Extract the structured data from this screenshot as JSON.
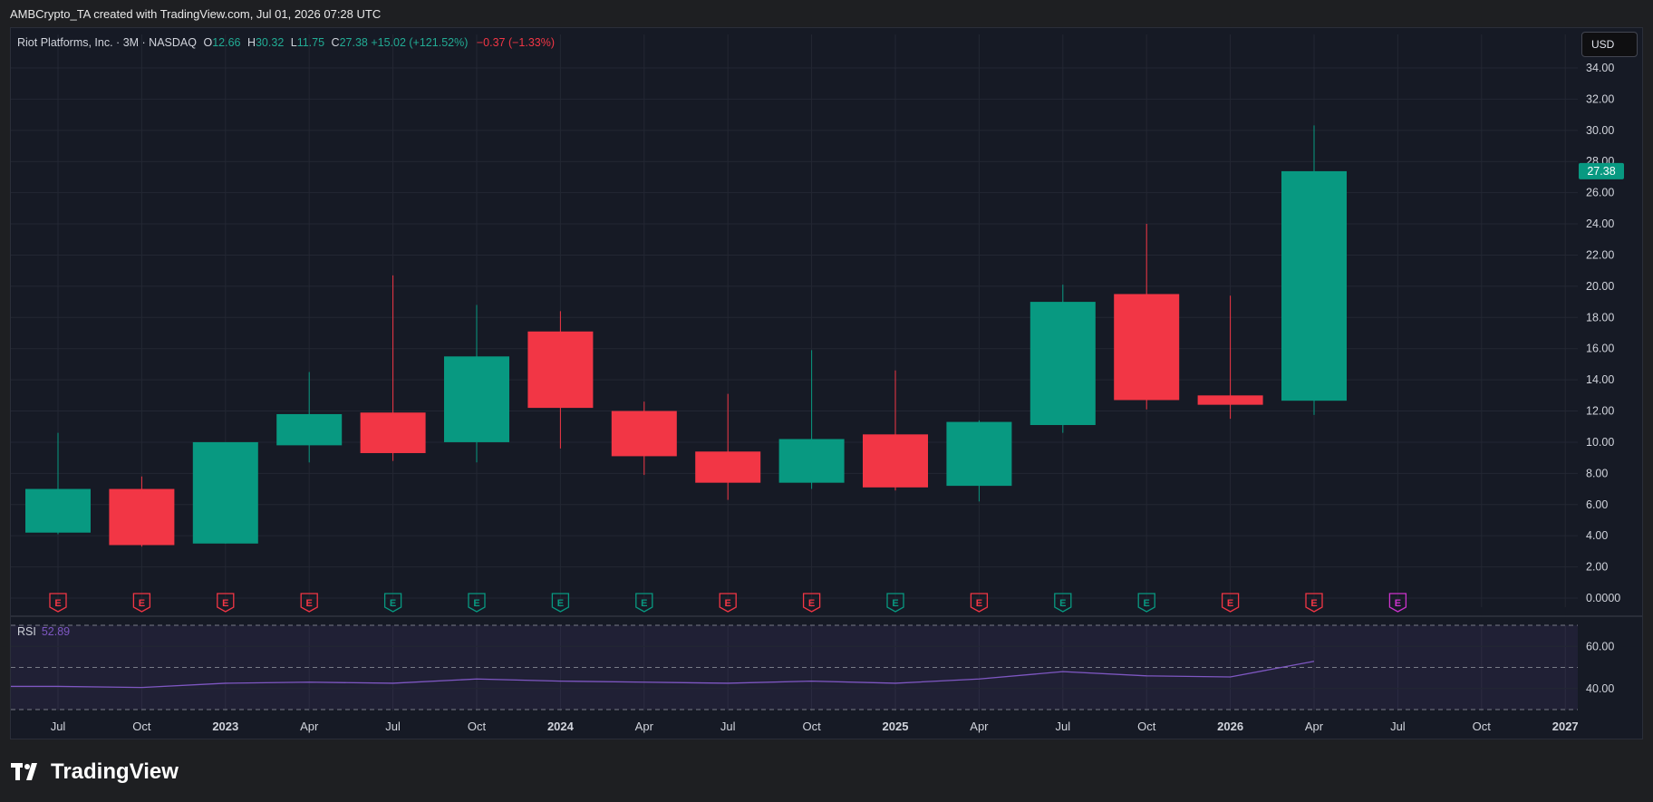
{
  "header": {
    "credit": "AMBCrypto_TA created with TradingView.com, Jul 01, 2026 07:28 UTC"
  },
  "legend": {
    "symbol": "Riot Platforms, Inc. · 3M · NASDAQ",
    "o_label": "O",
    "o_value": "12.66",
    "h_label": "H",
    "h_value": "30.32",
    "l_label": "L",
    "l_value": "11.75",
    "c_label": "C",
    "c_value": "27.38",
    "change": "+15.02 (+121.52%)",
    "day_change": "−0.37 (−1.33%)"
  },
  "currency_button": "USD",
  "rsi": {
    "label": "RSI",
    "value": "52.89"
  },
  "brand": {
    "name": "TradingView"
  },
  "colors": {
    "up": "#089981",
    "down": "#f23645",
    "rsi_line": "#7e57c2",
    "earnings_future": "#cc33cc"
  },
  "chart_data": {
    "type": "candlestick",
    "price_axis": {
      "ylim": [
        0,
        34
      ],
      "ticks": [
        "34.00",
        "32.00",
        "30.00",
        "28.00",
        "26.00",
        "24.00",
        "22.00",
        "20.00",
        "18.00",
        "16.00",
        "14.00",
        "12.00",
        "10.00",
        "8.00",
        "6.00",
        "4.00",
        "2.00",
        "0.0000"
      ],
      "last_price": "27.38"
    },
    "time_axis": {
      "ticks": [
        "Jul",
        "Oct",
        "2023",
        "Apr",
        "Jul",
        "Oct",
        "2024",
        "Apr",
        "Jul",
        "Oct",
        "2025",
        "Apr",
        "Jul",
        "Oct",
        "2026",
        "Apr",
        "Jul",
        "Oct",
        "2027"
      ],
      "bold": [
        "2023",
        "2024",
        "2025",
        "2026",
        "2027"
      ]
    },
    "candles": [
      {
        "period": "Jul 2022",
        "open": 4.2,
        "high": 10.6,
        "low": 4.1,
        "close": 7.0
      },
      {
        "period": "Oct 2022",
        "open": 7.0,
        "high": 7.8,
        "low": 3.3,
        "close": 3.4
      },
      {
        "period": "Jan 2023",
        "open": 3.5,
        "high": 10.0,
        "low": 3.5,
        "close": 10.0
      },
      {
        "period": "Apr 2023",
        "open": 9.8,
        "high": 14.5,
        "low": 8.7,
        "close": 11.8
      },
      {
        "period": "Jul 2023",
        "open": 11.9,
        "high": 20.7,
        "low": 8.8,
        "close": 9.3
      },
      {
        "period": "Oct 2023",
        "open": 10.0,
        "high": 18.8,
        "low": 8.7,
        "close": 15.5
      },
      {
        "period": "Jan 2024",
        "open": 17.1,
        "high": 18.4,
        "low": 9.6,
        "close": 12.2
      },
      {
        "period": "Apr 2024",
        "open": 12.0,
        "high": 12.6,
        "low": 7.9,
        "close": 9.1
      },
      {
        "period": "Jul 2024",
        "open": 9.4,
        "high": 13.1,
        "low": 6.3,
        "close": 7.4
      },
      {
        "period": "Oct 2024",
        "open": 7.4,
        "high": 15.9,
        "low": 7.0,
        "close": 10.2
      },
      {
        "period": "Jan 2025",
        "open": 10.5,
        "high": 14.6,
        "low": 6.9,
        "close": 7.1
      },
      {
        "period": "Apr 2025",
        "open": 7.2,
        "high": 11.4,
        "low": 6.2,
        "close": 11.3
      },
      {
        "period": "Jul 2025",
        "open": 11.1,
        "high": 20.1,
        "low": 10.6,
        "close": 19.0
      },
      {
        "period": "Oct 2025",
        "open": 19.5,
        "high": 24.0,
        "low": 12.1,
        "close": 12.7
      },
      {
        "period": "Jan 2026",
        "open": 13.0,
        "high": 19.4,
        "low": 11.5,
        "close": 12.4
      },
      {
        "period": "Apr 2026",
        "open": 12.66,
        "high": 30.32,
        "low": 11.75,
        "close": 27.38
      }
    ],
    "earnings_markers": [
      {
        "label": "E",
        "kind": "down"
      },
      {
        "label": "E",
        "kind": "down"
      },
      {
        "label": "E",
        "kind": "down"
      },
      {
        "label": "E",
        "kind": "down"
      },
      {
        "label": "E",
        "kind": "up"
      },
      {
        "label": "E",
        "kind": "up"
      },
      {
        "label": "E",
        "kind": "up"
      },
      {
        "label": "E",
        "kind": "up"
      },
      {
        "label": "E",
        "kind": "down"
      },
      {
        "label": "E",
        "kind": "down"
      },
      {
        "label": "E",
        "kind": "up"
      },
      {
        "label": "E",
        "kind": "down"
      },
      {
        "label": "E",
        "kind": "up"
      },
      {
        "label": "E",
        "kind": "up"
      },
      {
        "label": "E",
        "kind": "down"
      },
      {
        "label": "E",
        "kind": "down"
      },
      {
        "label": "E",
        "kind": "future"
      }
    ],
    "rsi_pane": {
      "ylim": [
        30,
        70
      ],
      "ticks": [
        "60.00",
        "40.00"
      ],
      "bands": [
        30,
        50,
        70
      ],
      "values": [
        41,
        40.5,
        42.5,
        43,
        42.5,
        44.5,
        43.5,
        43,
        42.5,
        43.5,
        42.5,
        44.5,
        48,
        46,
        45.5,
        52.89
      ]
    }
  }
}
